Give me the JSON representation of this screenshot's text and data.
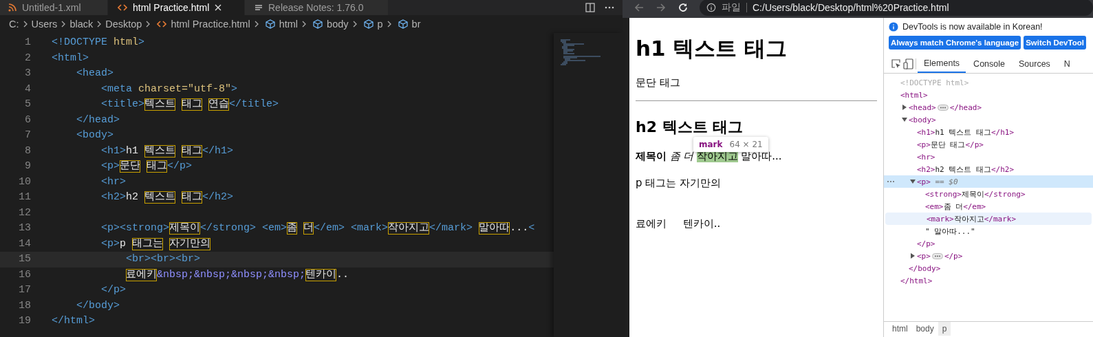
{
  "editor": {
    "tabs": [
      {
        "label": "Untitled-1.xml",
        "kind": "xml",
        "selected": false
      },
      {
        "label": "html Practice.html",
        "kind": "html",
        "selected": true
      },
      {
        "label": "Release Notes: 1.76.0",
        "kind": "notes",
        "selected": false
      }
    ],
    "breadcrumb": [
      {
        "text": "C:",
        "kind": "folder"
      },
      {
        "text": "Users",
        "kind": "folder"
      },
      {
        "text": "black",
        "kind": "folder"
      },
      {
        "text": "Desktop",
        "kind": "folder"
      },
      {
        "text": "html Practice.html",
        "kind": "file"
      },
      {
        "text": "html",
        "kind": "element"
      },
      {
        "text": "body",
        "kind": "element"
      },
      {
        "text": "p",
        "kind": "element"
      },
      {
        "text": "br",
        "kind": "element"
      }
    ],
    "lines": [
      {
        "num": "1",
        "current": false,
        "tokens": [
          {
            "kind": "tag",
            "text": "<!DOCTYPE"
          },
          {
            "kind": "attr",
            "text": " html"
          },
          {
            "kind": "tag",
            "text": ">"
          }
        ]
      },
      {
        "num": "2",
        "current": false,
        "tokens": [
          {
            "kind": "tag",
            "text": "<html>"
          }
        ]
      },
      {
        "num": "3",
        "current": false,
        "tokens": [
          {
            "kind": "tag",
            "text": "    <head>"
          }
        ]
      },
      {
        "num": "4",
        "current": false,
        "tokens": [
          {
            "kind": "tag",
            "text": "        <meta"
          },
          {
            "kind": "attr",
            "text": " charset=\"utf-8\""
          },
          {
            "kind": "tag",
            "text": ">"
          }
        ]
      },
      {
        "num": "5",
        "current": false,
        "tokens": [
          {
            "kind": "tag",
            "text": "        <title>"
          },
          {
            "kind": "kr",
            "text": "텍스트"
          },
          {
            "kind": "kr",
            "text": "태그",
            "space_before": true
          },
          {
            "kind": "kr",
            "text": "연습",
            "space_before": true
          },
          {
            "kind": "tag",
            "text": "</title>"
          }
        ]
      },
      {
        "num": "6",
        "current": false,
        "tokens": [
          {
            "kind": "tag",
            "text": "    </head>"
          }
        ]
      },
      {
        "num": "7",
        "current": false,
        "tokens": [
          {
            "kind": "tag",
            "text": "    <body>"
          }
        ]
      },
      {
        "num": "8",
        "current": false,
        "tokens": [
          {
            "kind": "tag",
            "text": "        <h1>"
          },
          {
            "kind": "text",
            "text": "h1 "
          },
          {
            "kind": "kr",
            "text": "텍스트"
          },
          {
            "kind": "kr",
            "text": "태그",
            "space_before": true
          },
          {
            "kind": "tag",
            "text": "</h1>"
          }
        ]
      },
      {
        "num": "9",
        "current": false,
        "tokens": [
          {
            "kind": "tag",
            "text": "        <p>"
          },
          {
            "kind": "kr",
            "text": "문단"
          },
          {
            "kind": "kr",
            "text": "태그",
            "space_before": true
          },
          {
            "kind": "tag",
            "text": "</p>"
          }
        ]
      },
      {
        "num": "10",
        "current": false,
        "tokens": [
          {
            "kind": "tag",
            "text": "        <hr>"
          }
        ]
      },
      {
        "num": "11",
        "current": false,
        "tokens": [
          {
            "kind": "tag",
            "text": "        <h2>"
          },
          {
            "kind": "text",
            "text": "h2 "
          },
          {
            "kind": "kr",
            "text": "텍스트"
          },
          {
            "kind": "kr",
            "text": "태그",
            "space_before": true
          },
          {
            "kind": "tag",
            "text": "</h2>"
          }
        ]
      },
      {
        "num": "12",
        "current": false
      },
      {
        "num": "13",
        "current": false,
        "tokens": [
          {
            "kind": "tag",
            "text": "        <p><strong>"
          },
          {
            "kind": "kr",
            "text": "제목이"
          },
          {
            "kind": "tag",
            "text": "</strong> <em>"
          },
          {
            "kind": "kr",
            "text": "좀"
          },
          {
            "kind": "kr",
            "text": "더",
            "space_before": true
          },
          {
            "kind": "tag",
            "text": "</em> <mark>"
          },
          {
            "kind": "kr",
            "text": "작아지고"
          },
          {
            "kind": "tag",
            "text": "</mark>"
          },
          {
            "kind": "kr",
            "text": "말아따",
            "space_before": true
          },
          {
            "kind": "text",
            "text": "..."
          },
          {
            "kind": "tag",
            "text": "<"
          }
        ]
      },
      {
        "num": "14",
        "current": false,
        "tokens": [
          {
            "kind": "tag",
            "text": "        <p>"
          },
          {
            "kind": "text",
            "text": "p "
          },
          {
            "kind": "kr",
            "text": "태그는"
          },
          {
            "kind": "kr",
            "text": "자기만의",
            "space_before": true
          }
        ]
      },
      {
        "num": "15",
        "current": true,
        "tokens": [
          {
            "kind": "tag",
            "text": "            <br><br><br>"
          }
        ]
      },
      {
        "num": "16",
        "current": false,
        "tokens": [
          {
            "kind": "kr",
            "text": "            료에키"
          },
          {
            "kind": "entity",
            "text": "&nbsp;&nbsp;&nbsp;&nbsp;"
          },
          {
            "kind": "kr",
            "text": "텐카이"
          },
          {
            "kind": "text",
            "text": ".."
          }
        ]
      },
      {
        "num": "17",
        "current": false,
        "tokens": [
          {
            "kind": "tag",
            "text": "        </p>"
          }
        ]
      },
      {
        "num": "18",
        "current": false,
        "tokens": [
          {
            "kind": "tag",
            "text": "    </body>"
          }
        ]
      },
      {
        "num": "19",
        "current": false,
        "tokens": [
          {
            "kind": "tag",
            "text": "</html>"
          }
        ]
      }
    ]
  },
  "browser": {
    "location_label": "파일",
    "url": "C:/Users/black/Desktop/html%20Practice.html",
    "page": {
      "h1": "h1 텍스트 태그",
      "p1": "문단 태그",
      "h2": "h2 텍스트 태그",
      "sentence": [
        {
          "kind": "strong",
          "text": "제목이"
        },
        {
          "kind": "em",
          "text": "좀 더"
        },
        {
          "kind": "mark",
          "text": "작아지고"
        },
        {
          "kind": "plain",
          "text": "말아따..."
        }
      ],
      "p2": "p 태그는 자기만의",
      "p3": "료에키     텐카이..",
      "tooltip": {
        "tag": "mark",
        "size": "64 × 21"
      }
    }
  },
  "devtools": {
    "notice": "DevTools is now available in Korean!",
    "buttons": [
      "Always match Chrome's language",
      "Switch DevTool"
    ],
    "tabs": [
      {
        "label": "Elements",
        "selected": true
      },
      {
        "label": "Console",
        "selected": false
      },
      {
        "label": "Sources",
        "selected": false
      },
      {
        "label": "N",
        "selected": false
      }
    ],
    "dom": [
      {
        "tokens": [
          {
            "kind": "muted",
            "text": "<!DOCTYPE html>"
          }
        ],
        "selected": false,
        "hovered": false
      },
      {
        "tokens": [
          {
            "kind": "tag",
            "text": "<html>"
          }
        ],
        "selected": false,
        "hovered": false,
        "close": [
          {
            "kind": "tag",
            "text": "</html>"
          }
        ],
        "children": [
          {
            "tokens": [
              {
                "kind": "tag",
                "text": "<head>"
              }
            ],
            "expanded": false,
            "tail": [
              {
                "kind": "tag",
                "text": "</head>"
              }
            ],
            "selected": false,
            "hovered": false
          },
          {
            "tokens": [
              {
                "kind": "tag",
                "text": "<body>"
              }
            ],
            "expanded": true,
            "close": [
              {
                "kind": "tag",
                "text": "</body>"
              }
            ],
            "selected": false,
            "hovered": false,
            "children": [
              {
                "tokens": [
                  {
                    "kind": "tag",
                    "text": "<h1>"
                  },
                  {
                    "kind": "text",
                    "text": "h1 텍스트 태그"
                  },
                  {
                    "kind": "tag",
                    "text": "</h1>"
                  }
                ],
                "selected": false,
                "hovered": false
              },
              {
                "tokens": [
                  {
                    "kind": "tag",
                    "text": "<p>"
                  },
                  {
                    "kind": "text",
                    "text": "문단 태그"
                  },
                  {
                    "kind": "tag",
                    "text": "</p>"
                  }
                ],
                "selected": false,
                "hovered": false
              },
              {
                "tokens": [
                  {
                    "kind": "tag",
                    "text": "<hr>"
                  }
                ],
                "selected": false,
                "hovered": false
              },
              {
                "tokens": [
                  {
                    "kind": "tag",
                    "text": "<h2>"
                  },
                  {
                    "kind": "text",
                    "text": "h2 텍스트 태그"
                  },
                  {
                    "kind": "tag",
                    "text": "</h2>"
                  }
                ],
                "selected": false,
                "hovered": false
              },
              {
                "tokens": [
                  {
                    "kind": "tag",
                    "text": "<p>"
                  },
                  {
                    "kind": "dollar",
                    "text": " == $0"
                  }
                ],
                "expanded": true,
                "close": [
                  {
                    "kind": "tag",
                    "text": "</p>"
                  }
                ],
                "selected": true,
                "hovered": false,
                "children": [
                  {
                    "tokens": [
                      {
                        "kind": "tag",
                        "text": "<strong>"
                      },
                      {
                        "kind": "text",
                        "text": "제목이"
                      },
                      {
                        "kind": "tag",
                        "text": "</strong>"
                      }
                    ],
                    "selected": false,
                    "hovered": false
                  },
                  {
                    "tokens": [
                      {
                        "kind": "tag",
                        "text": "<em>"
                      },
                      {
                        "kind": "text",
                        "text": "좀 더"
                      },
                      {
                        "kind": "tag",
                        "text": "</em>"
                      }
                    ],
                    "selected": false,
                    "hovered": false
                  },
                  {
                    "tokens": [
                      {
                        "kind": "tag",
                        "text": "<mark>"
                      },
                      {
                        "kind": "text",
                        "text": "작아지고"
                      },
                      {
                        "kind": "tag",
                        "text": "</mark>"
                      }
                    ],
                    "selected": false,
                    "hovered": true
                  },
                  {
                    "tokens": [
                      {
                        "kind": "text",
                        "text": "\" 말아따...\""
                      }
                    ],
                    "selected": false,
                    "hovered": false
                  }
                ]
              },
              {
                "tokens": [
                  {
                    "kind": "tag",
                    "text": "<p>"
                  }
                ],
                "expanded": false,
                "tail": [
                  {
                    "kind": "tag",
                    "text": "</p>"
                  }
                ],
                "selected": false,
                "hovered": false
              }
            ]
          }
        ]
      }
    ],
    "crumbs": [
      {
        "label": "html",
        "selected": false
      },
      {
        "label": "body",
        "selected": false
      },
      {
        "label": "p",
        "selected": true
      }
    ]
  }
}
